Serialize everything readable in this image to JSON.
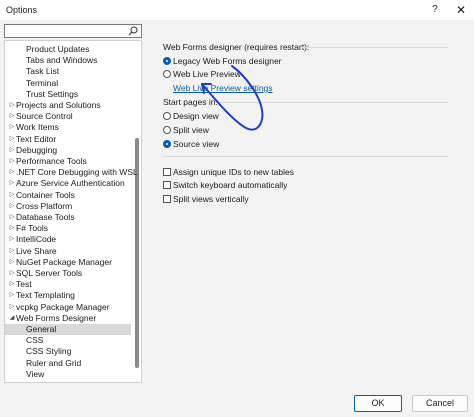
{
  "window": {
    "title": "Options",
    "help_glyph": "?",
    "close_glyph": "✕"
  },
  "search": {
    "value": "",
    "placeholder": ""
  },
  "tree": {
    "items": [
      {
        "label": "Product Updates",
        "level": 1,
        "arrow": ""
      },
      {
        "label": "Tabs and Windows",
        "level": 1,
        "arrow": ""
      },
      {
        "label": "Task List",
        "level": 1,
        "arrow": ""
      },
      {
        "label": "Terminal",
        "level": 1,
        "arrow": ""
      },
      {
        "label": "Trust Settings",
        "level": 1,
        "arrow": ""
      },
      {
        "label": "Projects and Solutions",
        "level": 0,
        "arrow": "collapsed"
      },
      {
        "label": "Source Control",
        "level": 0,
        "arrow": "collapsed"
      },
      {
        "label": "Work Items",
        "level": 0,
        "arrow": "collapsed"
      },
      {
        "label": "Text Editor",
        "level": 0,
        "arrow": "collapsed"
      },
      {
        "label": "Debugging",
        "level": 0,
        "arrow": "collapsed"
      },
      {
        "label": "Performance Tools",
        "level": 0,
        "arrow": "collapsed"
      },
      {
        "label": ".NET Core Debugging with WSL",
        "level": 0,
        "arrow": "collapsed"
      },
      {
        "label": "Azure Service Authentication",
        "level": 0,
        "arrow": "collapsed"
      },
      {
        "label": "Container Tools",
        "level": 0,
        "arrow": "collapsed"
      },
      {
        "label": "Cross Platform",
        "level": 0,
        "arrow": "collapsed"
      },
      {
        "label": "Database Tools",
        "level": 0,
        "arrow": "collapsed"
      },
      {
        "label": "F# Tools",
        "level": 0,
        "arrow": "collapsed"
      },
      {
        "label": "IntelliCode",
        "level": 0,
        "arrow": "collapsed"
      },
      {
        "label": "Live Share",
        "level": 0,
        "arrow": "collapsed"
      },
      {
        "label": "NuGet Package Manager",
        "level": 0,
        "arrow": "collapsed"
      },
      {
        "label": "SQL Server Tools",
        "level": 0,
        "arrow": "collapsed"
      },
      {
        "label": "Test",
        "level": 0,
        "arrow": "collapsed"
      },
      {
        "label": "Text Templating",
        "level": 0,
        "arrow": "collapsed"
      },
      {
        "label": "vcpkg Package Manager",
        "level": 0,
        "arrow": "collapsed"
      },
      {
        "label": "Web Forms Designer",
        "level": 0,
        "arrow": "expanded"
      },
      {
        "label": "General",
        "level": 1,
        "arrow": "",
        "selected": true
      },
      {
        "label": "CSS",
        "level": 1,
        "arrow": ""
      },
      {
        "label": "CSS Styling",
        "level": 1,
        "arrow": ""
      },
      {
        "label": "Ruler and Grid",
        "level": 1,
        "arrow": ""
      },
      {
        "label": "View",
        "level": 1,
        "arrow": ""
      }
    ]
  },
  "designer_group": {
    "label": "Web Forms designer (requires restart):",
    "options": [
      {
        "label": "Legacy Web Forms designer",
        "checked": true
      },
      {
        "label": "Web Live Preview",
        "checked": false
      }
    ],
    "link": "Web Live Preview settings"
  },
  "start_pages": {
    "label": "Start pages in:",
    "options": [
      {
        "label": "Design view",
        "checked": false
      },
      {
        "label": "Split view",
        "checked": false
      },
      {
        "label": "Source view",
        "checked": true
      }
    ]
  },
  "checkboxes": [
    {
      "label": "Assign unique IDs to new tables",
      "checked": false
    },
    {
      "label": "Switch keyboard automatically",
      "checked": false
    },
    {
      "label": "Split views vertically",
      "checked": false
    }
  ],
  "buttons": {
    "ok": "OK",
    "cancel": "Cancel"
  },
  "colors": {
    "accent": "#005fb8",
    "annotation": "#1f3fbf",
    "link": "#0b5cad"
  }
}
